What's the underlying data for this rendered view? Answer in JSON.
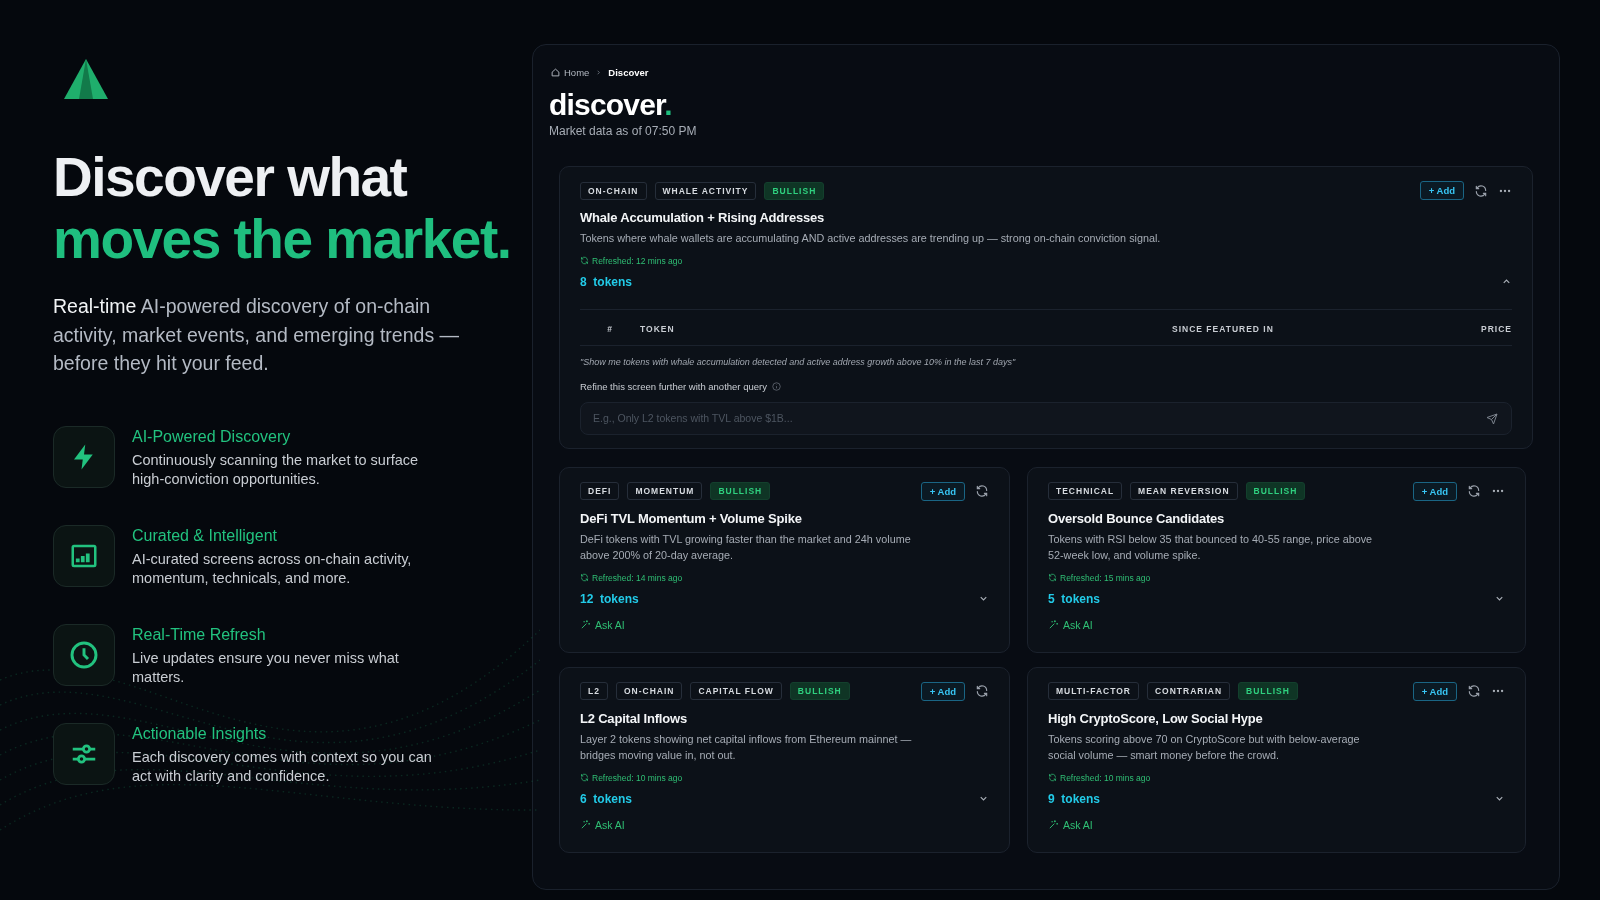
{
  "hero": {
    "title_line1": "Discover what",
    "title_line2": "moves the market.",
    "subtitle": "**Real-time** AI-powered discovery of on-chain activity, market events, and emerging trends — before they hit your feed."
  },
  "features": [
    {
      "kind": "bolt",
      "title": "AI-Powered Discovery",
      "text": "Continuously scanning the market to surface high-conviction opportunities."
    },
    {
      "kind": "chart",
      "title": "Curated & Intelligent",
      "text": "AI-curated screens across on-chain activity, momentum, technicals, and more."
    },
    {
      "kind": "clock",
      "title": "Real-Time Refresh",
      "text": "Live updates ensure you never miss what matters."
    },
    {
      "kind": "sliders",
      "title": "Actionable Insights",
      "text": "Each discovery comes with context so you can act with clarity and confidence."
    }
  ],
  "app": {
    "breadcrumb": {
      "home": "Home",
      "current": "Discover"
    },
    "title": "discover",
    "title_accent": ".",
    "as_of": "Market data as of 07:50 PM",
    "featured": {
      "tags": [
        {
          "label": "ON-CHAIN",
          "kind": "category"
        },
        {
          "label": "WHALE ACTIVITY",
          "kind": "category"
        },
        {
          "label": "BULLISH",
          "kind": "sentiment"
        }
      ],
      "add": "+ Add",
      "more_menu": true,
      "title": "Whale Accumulation + Rising Addresses",
      "description": "Tokens where whale wallets are accumulating AND active addresses are trending up — strong on-chain conviction signal.",
      "refreshed": "Refreshed: 12 mins ago",
      "tokens": "8  tokens",
      "expanded": true,
      "columns": [
        "#",
        "TOKEN",
        "SINCE FEATURED IN",
        "PRICE"
      ],
      "query": "\"Show me tokens with whale accumulation detected and active address growth above 10% in the last 7 days\"",
      "refine_label": "Refine this screen further with another query",
      "placeholder": "E.g., Only L2 tokens with TVL above $1B..."
    },
    "screens": [
      {
        "tags": [
          {
            "label": "DEFI",
            "kind": "category"
          },
          {
            "label": "MOMENTUM",
            "kind": "category"
          },
          {
            "label": "BULLISH",
            "kind": "sentiment"
          }
        ],
        "add": "+ Add",
        "more_menu": false,
        "title": "DeFi TVL Momentum + Volume Spike",
        "description": "DeFi tokens with TVL growing faster than the market and 24h volume above 200% of 20-day average.",
        "refreshed": "Refreshed: 14 mins ago",
        "tokens": "12  tokens",
        "expanded": false,
        "ask": "Ask AI"
      },
      {
        "tags": [
          {
            "label": "TECHNICAL",
            "kind": "category"
          },
          {
            "label": "MEAN REVERSION",
            "kind": "category"
          },
          {
            "label": "BULLISH",
            "kind": "sentiment"
          }
        ],
        "add": "+ Add",
        "more_menu": true,
        "title": "Oversold Bounce Candidates",
        "description": "Tokens with RSI below 35 that bounced to 40-55 range, price above 52-week low, and volume spike.",
        "refreshed": "Refreshed: 15 mins ago",
        "tokens": "5  tokens",
        "expanded": false,
        "ask": "Ask AI"
      },
      {
        "tags": [
          {
            "label": "L2",
            "kind": "category"
          },
          {
            "label": "ON-CHAIN",
            "kind": "category"
          },
          {
            "label": "CAPITAL FLOW",
            "kind": "category"
          },
          {
            "label": "BULLISH",
            "kind": "sentiment"
          }
        ],
        "add": "+ Add",
        "more_menu": false,
        "title": "L2 Capital Inflows",
        "description": "Layer 2 tokens showing net capital inflows from Ethereum mainnet — bridges moving value in, not out.",
        "refreshed": "Refreshed: 10 mins ago",
        "tokens": "6  tokens",
        "expanded": false,
        "ask": "Ask AI"
      },
      {
        "tags": [
          {
            "label": "MULTI-FACTOR",
            "kind": "category"
          },
          {
            "label": "CONTRARIAN",
            "kind": "category"
          },
          {
            "label": "BULLISH",
            "kind": "sentiment"
          }
        ],
        "add": "+ Add",
        "more_menu": true,
        "title": "High CryptoScore, Low Social Hype",
        "description": "Tokens scoring above 70 on CryptoScore but with below-average social volume — smart money before the crowd.",
        "refreshed": "Refreshed: 10 mins ago",
        "tokens": "9  tokens",
        "expanded": false,
        "ask": "Ask AI"
      }
    ]
  }
}
